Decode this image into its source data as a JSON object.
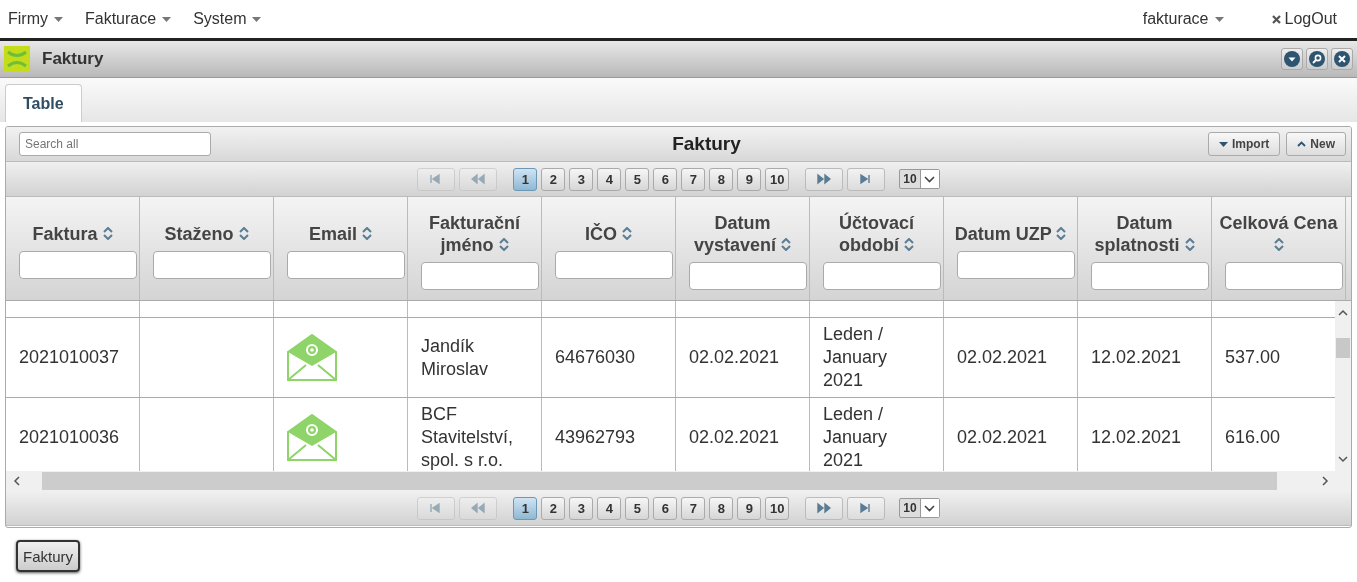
{
  "nav": {
    "menus": [
      {
        "label": "Firmy"
      },
      {
        "label": "Fakturace"
      },
      {
        "label": "System"
      }
    ],
    "user": "fakturace",
    "logout": "LogOut"
  },
  "window": {
    "title": "Faktury"
  },
  "tabs": [
    {
      "label": "Table",
      "selected": true
    }
  ],
  "grid": {
    "search": {
      "placeholder": "Search all"
    },
    "title": "Faktury",
    "buttons": [
      {
        "label": "Import",
        "kind": "down"
      },
      {
        "label": "New",
        "kind": "up"
      }
    ],
    "pager_top": {
      "pages": [
        {
          "label": "1",
          "selected": true
        },
        {
          "label": "2",
          "selected": false
        },
        {
          "label": "3",
          "selected": false
        },
        {
          "label": "4",
          "selected": false
        },
        {
          "label": "5",
          "selected": false
        },
        {
          "label": "6",
          "selected": false
        },
        {
          "label": "7",
          "selected": false
        },
        {
          "label": "8",
          "selected": false
        },
        {
          "label": "9",
          "selected": false
        },
        {
          "label": "10",
          "selected": false
        }
      ],
      "page_size": "10"
    },
    "columns": [
      {
        "label": "Faktura"
      },
      {
        "label": "Staženo"
      },
      {
        "label": "Email"
      },
      {
        "label": "Fakturační jméno"
      },
      {
        "label": "IČO"
      },
      {
        "label": "Datum vystavení"
      },
      {
        "label": "Účtovací období"
      },
      {
        "label": "Datum UZP"
      },
      {
        "label": "Datum splatnosti"
      },
      {
        "label": "Celková Cena"
      }
    ],
    "rows": [
      {
        "faktura": "2021010037",
        "stazeno": "",
        "email": true,
        "jmeno": "Jandík Miroslav",
        "ico": "64676030",
        "vystaveni": "02.02.2021",
        "obdobi": "Leden / January 2021",
        "uzp": "02.02.2021",
        "splatnost": "12.02.2021",
        "cena": "537.00"
      },
      {
        "faktura": "2021010036",
        "stazeno": "",
        "email": true,
        "jmeno": "BCF Stavitelství, spol. s r.o.",
        "ico": "43962793",
        "vystaveni": "02.02.2021",
        "obdobi": "Leden / January 2021",
        "uzp": "02.02.2021",
        "splatnost": "12.02.2021",
        "cena": "616.00"
      }
    ],
    "pager_bottom": {
      "pages": [
        {
          "label": "1",
          "selected": true
        },
        {
          "label": "2",
          "selected": false
        },
        {
          "label": "3",
          "selected": false
        },
        {
          "label": "4",
          "selected": false
        },
        {
          "label": "5",
          "selected": false
        },
        {
          "label": "6",
          "selected": false
        },
        {
          "label": "7",
          "selected": false
        },
        {
          "label": "8",
          "selected": false
        },
        {
          "label": "9",
          "selected": false
        },
        {
          "label": "10",
          "selected": false
        }
      ],
      "page_size": "10"
    }
  },
  "taskbar": [
    {
      "label": "Faktury"
    }
  ]
}
